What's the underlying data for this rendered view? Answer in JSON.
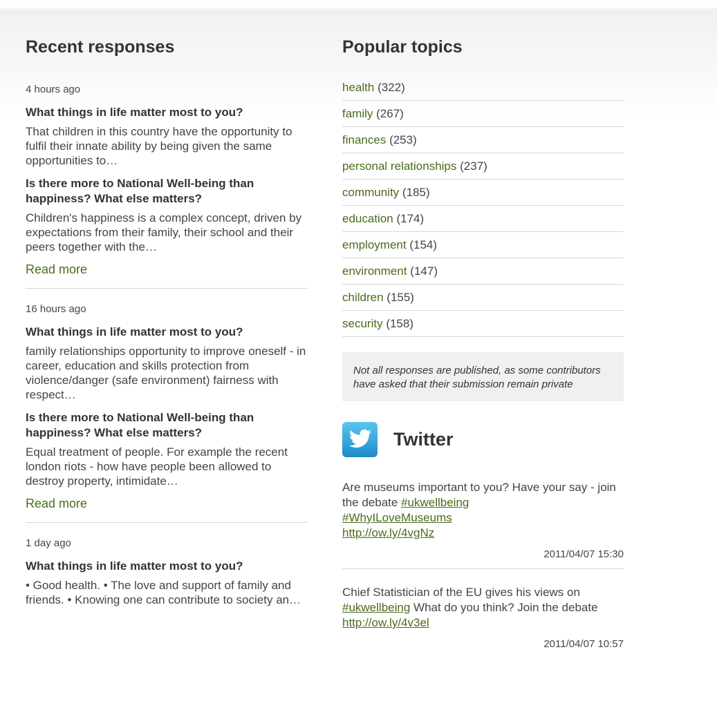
{
  "left": {
    "heading": "Recent responses",
    "responses": [
      {
        "time": "4 hours ago",
        "q1": "What things in life matter most to you?",
        "a1": "That children in this country have the opportunity to fulfil their innate ability by being given the same opportunities to…",
        "q2": "Is there more to National Well-being than happiness? What else matters?",
        "a2": "Children's happiness is a complex concept, driven by expectations from their family, their school and their peers together with the…",
        "read_more": "Read more"
      },
      {
        "time": "16 hours ago",
        "q1": "What things in life matter most to you?",
        "a1": "family relationships opportunity to improve oneself - in career, education and skills protection from violence/danger (safe environment) fairness with respect…",
        "q2": "Is there more to National Well-being than happiness? What else matters?",
        "a2": "Equal treatment of people. For example the recent london riots - how have people been allowed to destroy property, intimidate…",
        "read_more": "Read more"
      },
      {
        "time": "1 day ago",
        "q1": "What things in life matter most to you?",
        "a1": "• Good health. • The love and support of family and friends. • Knowing one can contribute to society an…"
      }
    ]
  },
  "right": {
    "heading": "Popular topics",
    "topics": [
      {
        "name": "health",
        "count": "(322)"
      },
      {
        "name": "family",
        "count": "(267)"
      },
      {
        "name": "finances",
        "count": "(253)"
      },
      {
        "name": "personal relationships",
        "count": "(237)"
      },
      {
        "name": "community",
        "count": "(185)"
      },
      {
        "name": "education",
        "count": "(174)"
      },
      {
        "name": "employment",
        "count": "(154)"
      },
      {
        "name": "environment",
        "count": "(147)"
      },
      {
        "name": "children",
        "count": "(155)"
      },
      {
        "name": "security",
        "count": "(158)"
      }
    ],
    "note": "Not all responses are published, as some contributors have asked that their submission remain private",
    "twitter": {
      "title": "Twitter",
      "icon": "twitter-bird-icon",
      "tweets": [
        {
          "text_before": "Are museums important to you? Have your say - join the debate ",
          "hash1": "#ukwellbeing",
          "hash2": "#WhyILoveMuseums",
          "link": "http://ow.ly/4vgNz",
          "date": "2011/04/07 15:30"
        },
        {
          "text_before": "Chief Statistician of the EU gives his views on ",
          "hash1": "#ukwellbeing",
          "text_after": " What do you think? Join the debate",
          "link": "http://ow.ly/4v3el",
          "date": "2011/04/07 10:57"
        }
      ]
    }
  },
  "colors": {
    "link": "#4a6b1c",
    "text": "#444444",
    "heading": "#333333",
    "note_bg": "#f0f0f0",
    "twitter_blue": "#2a9fd8"
  }
}
